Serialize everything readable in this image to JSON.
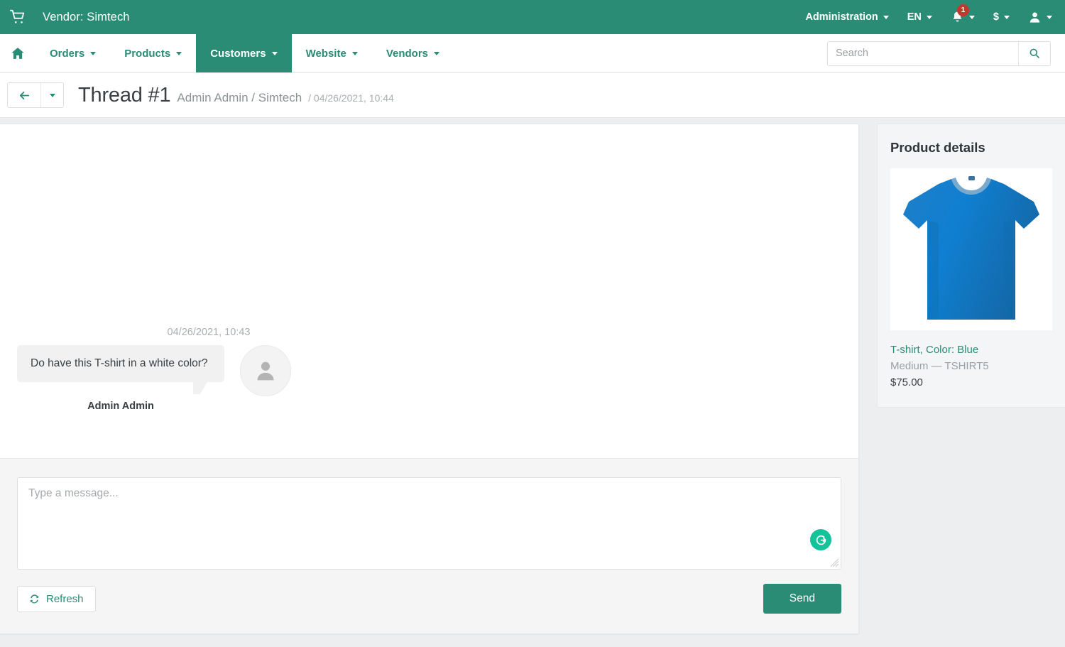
{
  "topbar": {
    "logo_icon": "shopping-cart-icon",
    "vendor_label": "Vendor: Simtech",
    "administration_label": "Administration",
    "language_label": "EN",
    "notifications_count": "1",
    "currency_label": "$",
    "account_icon": "user-icon",
    "accent_color": "#2b8c76",
    "badge_color": "#c0392b"
  },
  "nav": {
    "home_icon": "home-icon",
    "items": [
      {
        "label": "Orders",
        "active": false
      },
      {
        "label": "Products",
        "active": false
      },
      {
        "label": "Customers",
        "active": true
      },
      {
        "label": "Website",
        "active": false
      },
      {
        "label": "Vendors",
        "active": false
      }
    ]
  },
  "search": {
    "placeholder": "Search",
    "value": "",
    "button_icon": "search-icon"
  },
  "titlebar": {
    "back_icon": "arrow-left-icon",
    "back_caret_icon": "chevron-down-icon",
    "title": "Thread #1",
    "subtitle": "Admin Admin / Simtech",
    "date": "/ 04/26/2021, 10:44"
  },
  "thread": {
    "messages": [
      {
        "timestamp": "04/26/2021, 10:43",
        "text": "Do have this T-shirt in a white color?",
        "author": "Admin Admin",
        "avatar_icon": "user-avatar-icon"
      }
    ]
  },
  "compose": {
    "placeholder": "Type a message...",
    "value": "",
    "grammarly_icon": "grammarly-icon",
    "refresh_label": "Refresh",
    "refresh_icon": "refresh-icon",
    "send_label": "Send"
  },
  "product": {
    "panel_title": "Product details",
    "image_icon": "blue-tshirt-image",
    "name": "T-shirt, Color: Blue",
    "variant": "Medium — TSHIRT5",
    "price": "$75.00",
    "link_color": "#2b8c76"
  }
}
